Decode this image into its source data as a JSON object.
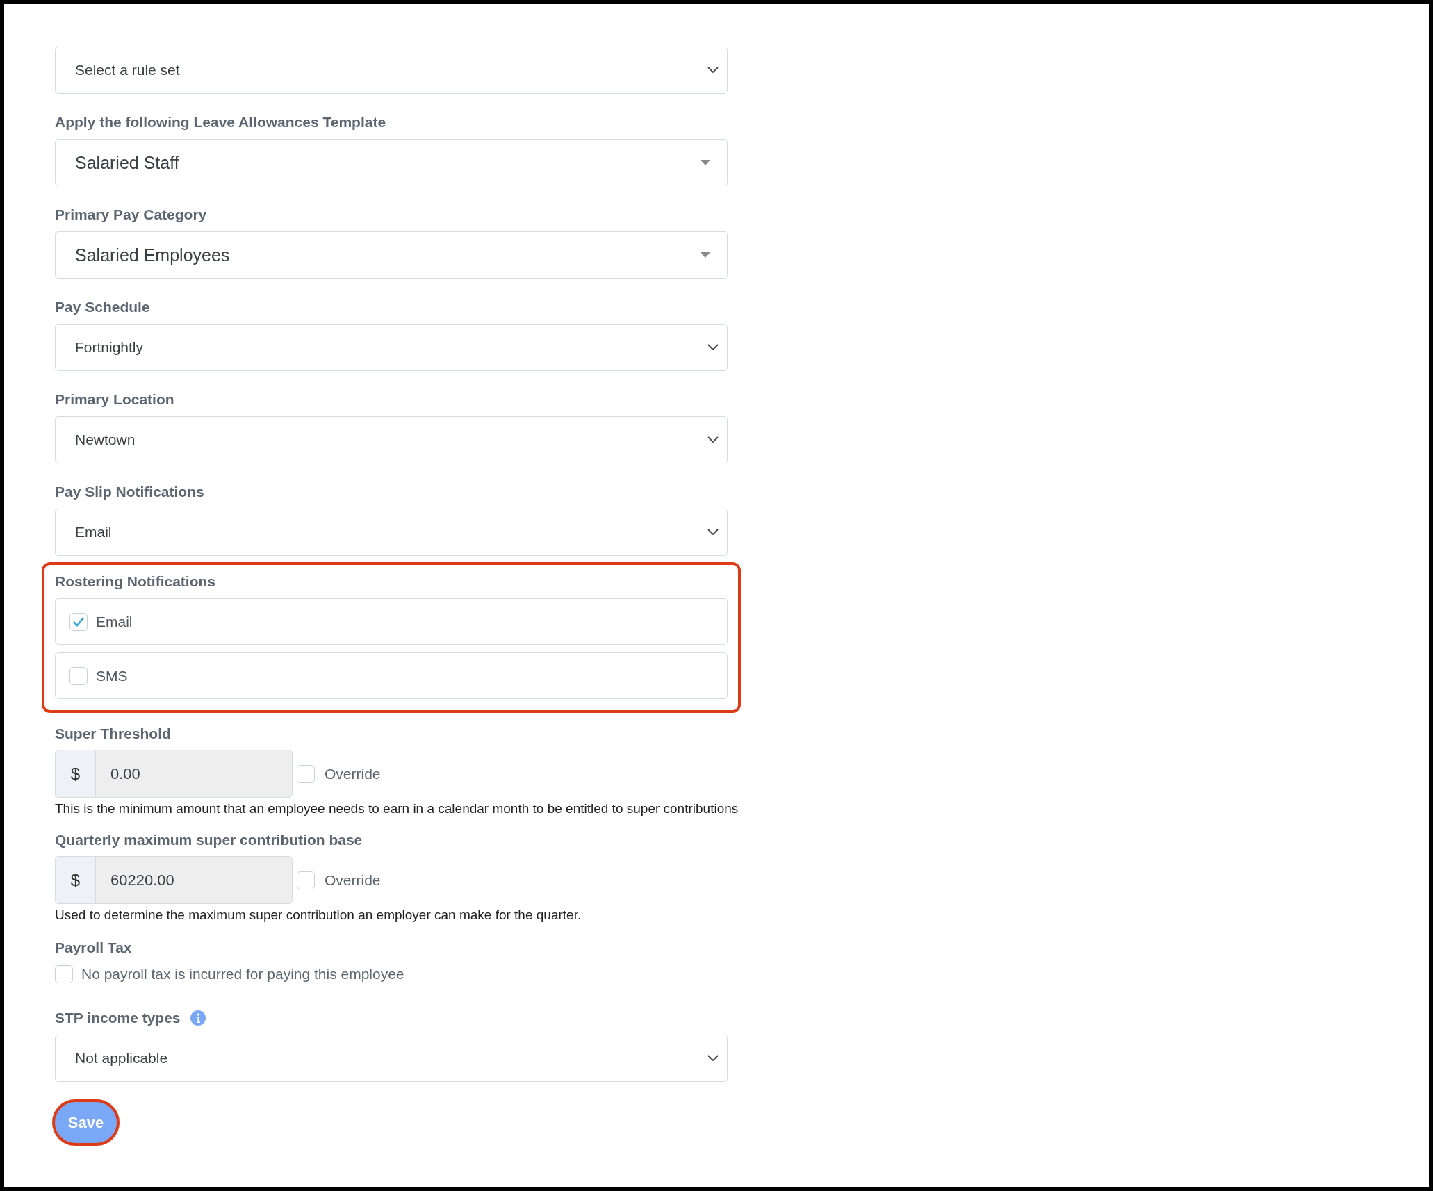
{
  "fields": [
    {
      "kind": "select",
      "value": "Select a rule set"
    },
    {
      "kind": "combo",
      "label": "Apply the following Leave Allowances Template",
      "value": "Salaried Staff"
    },
    {
      "kind": "combo",
      "label": "Primary Pay Category",
      "value": "Salaried Employees"
    },
    {
      "kind": "select",
      "label": "Pay Schedule",
      "value": "Fortnightly"
    },
    {
      "kind": "select",
      "label": "Primary Location",
      "value": "Newtown"
    },
    {
      "kind": "select",
      "label": "Pay Slip Notifications",
      "value": "Email"
    },
    {
      "kind": "checks",
      "label": "Rostering Notifications",
      "highlighted": true,
      "options": [
        {
          "label": "Email",
          "checked": true
        },
        {
          "label": "SMS",
          "checked": false
        }
      ]
    },
    {
      "kind": "money",
      "label": "Super Threshold",
      "symbol": "$",
      "value": "0.00",
      "override": {
        "label": "Override",
        "checked": false
      },
      "help": "This is the minimum amount that an employee needs to earn in a calendar month to be entitled to super contributions"
    },
    {
      "kind": "money",
      "label": "Quarterly maximum super contribution base",
      "symbol": "$",
      "value": "60220.00",
      "override": {
        "label": "Override",
        "checked": false
      },
      "help": "Used to determine the maximum super contribution an employer can make for the quarter."
    },
    {
      "kind": "checkbox",
      "label": "Payroll Tax",
      "option": {
        "label": "No payroll tax is incurred for paying this employee",
        "checked": false
      }
    },
    {
      "kind": "select",
      "label": "STP income types",
      "info": true,
      "value": "Not applicable"
    }
  ],
  "save": {
    "label": "Save",
    "highlighted": true
  }
}
